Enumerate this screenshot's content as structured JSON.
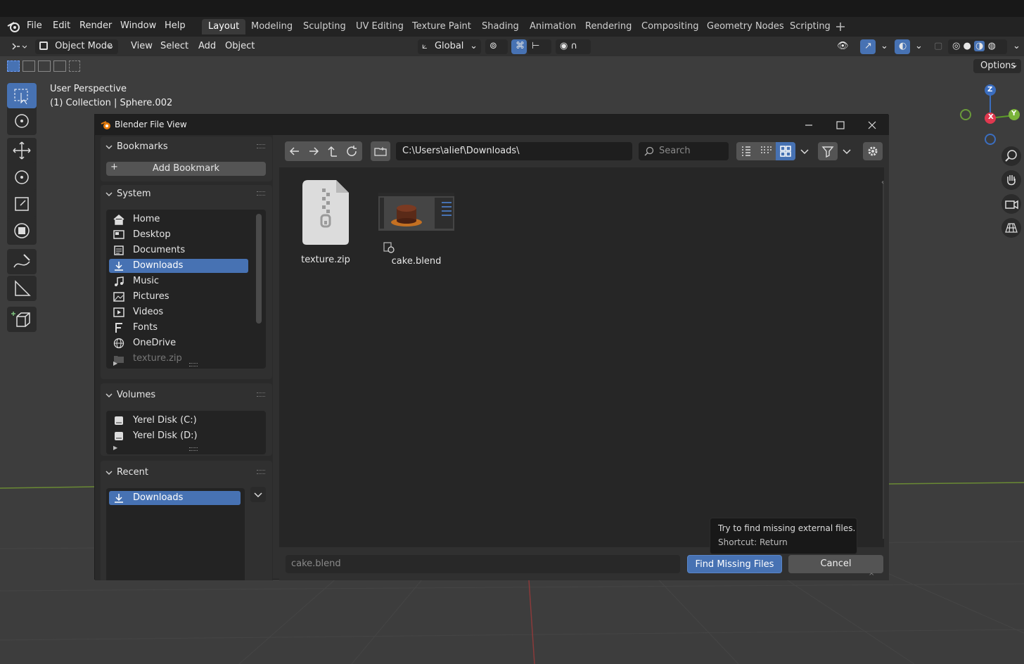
{
  "top_menu": [
    "File",
    "Edit",
    "Render",
    "Window",
    "Help"
  ],
  "workspaces": [
    "Layout",
    "Modeling",
    "Sculpting",
    "UV Editing",
    "Texture Paint",
    "Shading",
    "Animation",
    "Rendering",
    "Compositing",
    "Geometry Nodes",
    "Scripting"
  ],
  "header": {
    "mode": "Object Mode",
    "menus": [
      "View",
      "Select",
      "Add",
      "Object"
    ],
    "orientation": "Global",
    "options_label": "Options"
  },
  "viewport": {
    "perspective": "User Perspective",
    "collection": "(1) Collection | Sphere.002",
    "gizmo": {
      "z": "Z",
      "y": "Y",
      "x": "X"
    }
  },
  "dialog": {
    "title": "Blender File View",
    "bookmarks": {
      "title": "Bookmarks",
      "add_label": "Add Bookmark"
    },
    "system": {
      "title": "System",
      "items": [
        {
          "label": "Home",
          "icon": "home-icon",
          "selected": false
        },
        {
          "label": "Desktop",
          "icon": "desktop-icon",
          "selected": false
        },
        {
          "label": "Documents",
          "icon": "documents-icon",
          "selected": false
        },
        {
          "label": "Downloads",
          "icon": "download-icon",
          "selected": true
        },
        {
          "label": "Music",
          "icon": "music-icon",
          "selected": false
        },
        {
          "label": "Pictures",
          "icon": "pictures-icon",
          "selected": false
        },
        {
          "label": "Videos",
          "icon": "videos-icon",
          "selected": false
        },
        {
          "label": "Fonts",
          "icon": "font-icon",
          "selected": false
        },
        {
          "label": "OneDrive",
          "icon": "globe-icon",
          "selected": false
        },
        {
          "label": "texture.zip",
          "icon": "folder-icon",
          "selected": false
        }
      ]
    },
    "volumes": {
      "title": "Volumes",
      "items": [
        {
          "label": "Yerel Disk (C:)",
          "icon": "disk-icon"
        },
        {
          "label": "Yerel Disk (D:)",
          "icon": "disk-icon"
        }
      ]
    },
    "recent": {
      "title": "Recent",
      "items": [
        {
          "label": "Downloads",
          "icon": "download-icon",
          "selected": true
        }
      ]
    },
    "path": "C:\\Users\\alief\\Downloads\\",
    "search_placeholder": "Search",
    "files": [
      {
        "name": "texture.zip",
        "icon": "zip-file-icon"
      },
      {
        "name": "cake.blend",
        "icon": "blend-thumbnail"
      }
    ],
    "filename": "cake.blend",
    "primary_button": "Find Missing Files",
    "cancel_button": "Cancel",
    "tooltip": {
      "line1": "Try to find missing external files.",
      "line2": "Shortcut: Return"
    }
  }
}
